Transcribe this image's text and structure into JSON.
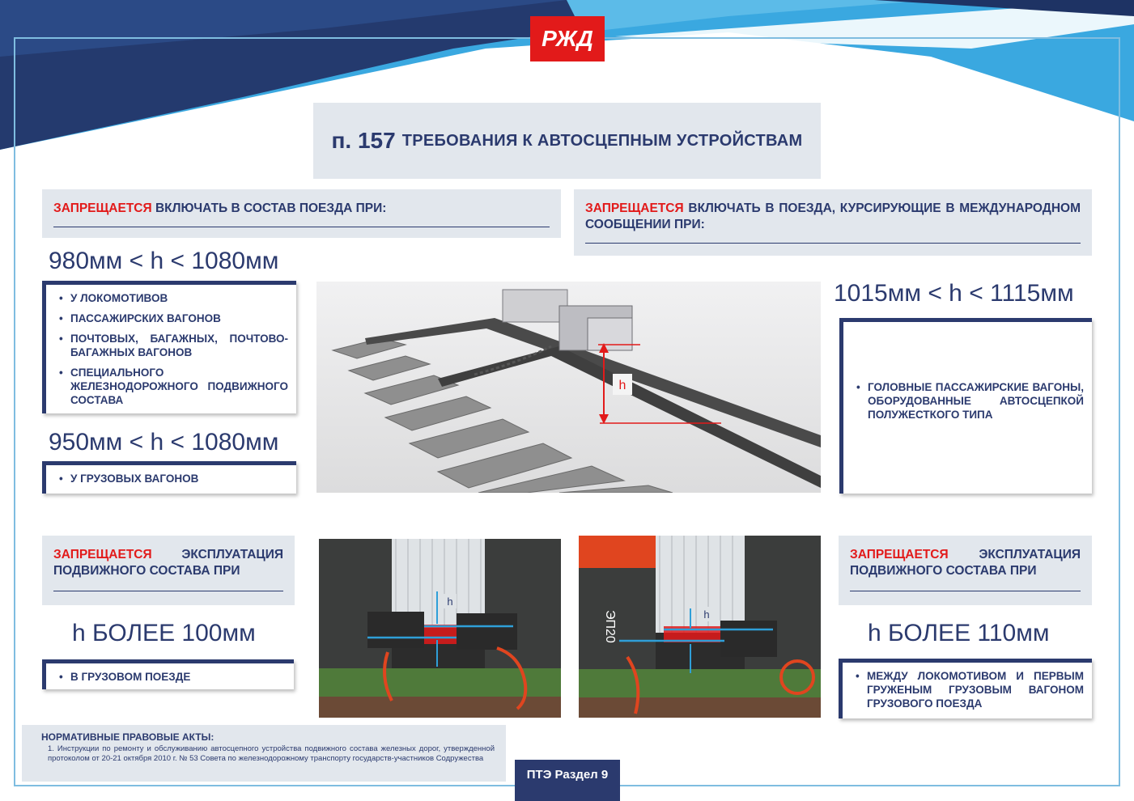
{
  "brand": {
    "logo_text": "РЖД",
    "red": "#e21a1a",
    "navy": "#2b3a6e",
    "panel_grey": "#e2e7ed",
    "sky": "#2f9fd8"
  },
  "title": {
    "number": "п. 157",
    "text": "ТРЕБОВАНИЯ К АВТОСЦЕПНЫМ УСТРОЙСТВАМ"
  },
  "left_header": {
    "red": "ЗАПРЕЩАЕТСЯ",
    "rest": "ВКЛЮЧАТЬ В СОСТАВ ПОЕЗДА ПРИ:"
  },
  "right_header": {
    "red": "ЗАПРЕЩАЕТСЯ",
    "rest": "ВКЛЮЧАТЬ В ПОЕЗДА, КУРСИРУЮЩИЕ В МЕЖДУНАРОДНОМ СООБЩЕНИИ ПРИ:"
  },
  "range_980": "980мм < h < 1080мм",
  "list_980": [
    "У ЛОКОМОТИВОВ",
    "ПАССАЖИРСКИХ ВАГОНОВ",
    "ПОЧТОВЫХ, БАГАЖНЫХ, ПОЧТОВО-БАГАЖНЫХ ВАГОНОВ",
    "СПЕЦИАЛЬНОГО ЖЕЛЕЗНОДОРОЖНОГО ПОДВИЖНОГО СОСТАВА"
  ],
  "range_950": "950мм < h < 1080мм",
  "list_950": [
    "У ГРУЗОВЫХ ВАГОНОВ"
  ],
  "range_1015": "1015мм < h < 1115мм",
  "list_1015": [
    "ГОЛОВНЫЕ ПАССАЖИРСКИЕ ВАГОНЫ, ОБОРУДОВАННЫЕ АВТОСЦЕПКОЙ ПОЛУЖЕСТКОГО ТИПА"
  ],
  "center_image": {
    "h_label": "h"
  },
  "bottom_left_header": {
    "red": "ЗАПРЕЩАЕТСЯ",
    "rest": "ЭКСПЛУАТАЦИЯ ПОДВИЖНОГО СОСТАВА ПРИ"
  },
  "bottom_left_value": "h БОЛЕЕ 100мм",
  "bottom_left_list": [
    "В ГРУЗОВОМ ПОЕЗДЕ"
  ],
  "bottom_right_header": {
    "red": "ЗАПРЕЩАЕТСЯ",
    "rest": "ЭКСПЛУАТАЦИЯ ПОДВИЖНОГО СОСТАВА ПРИ"
  },
  "bottom_right_value": "h БОЛЕЕ 110мм",
  "bottom_right_list": [
    "МЕЖДУ ЛОКОМОТИВОМ И ПЕРВЫМ ГРУЖЕНЫМ ГРУЗОВЫМ ВАГОНОМ ГРУЗОВОГО ПОЕЗДА"
  ],
  "freight_image": {
    "h_label": "h"
  },
  "loco_image": {
    "h_label": "h",
    "loco_label": "ЭП20"
  },
  "normative": {
    "heading": "НОРМАТИВНЫЕ ПРАВОВЫЕ АКТЫ:",
    "item": "1. Инструкции по ремонту и обслуживанию автосцепного устройства подвижного состава железных дорог, утвержденной протоколом от 20-21 октября 2010 г. № 53 Совета по железнодорожному транспорту государств-участников Содружества"
  },
  "badge": "ПТЭ Раздел 9"
}
